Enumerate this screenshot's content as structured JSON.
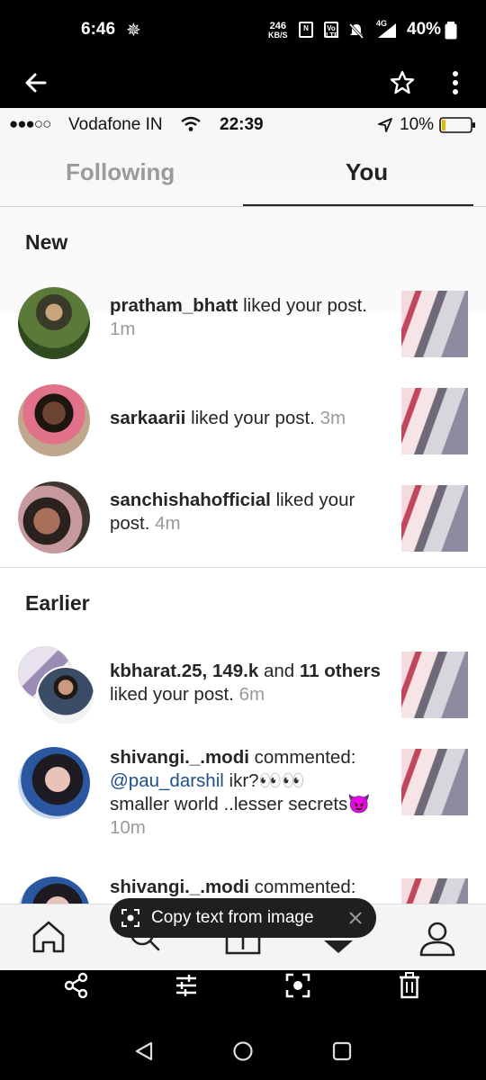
{
  "system_status": {
    "time": "6:46",
    "net_speed_value": "246",
    "net_speed_unit": "KB/S",
    "volte_label": "Vo LTE",
    "network_label": "4G",
    "battery": "40%"
  },
  "ios_status": {
    "carrier": "Vodafone IN",
    "time": "22:39",
    "battery": "10%",
    "signal_dots": "●●●○○"
  },
  "tabs": [
    {
      "label": "Following",
      "active": false
    },
    {
      "label": "You",
      "active": true
    }
  ],
  "sections": {
    "new_title": "New",
    "earlier_title": "Earlier"
  },
  "notifications": [
    {
      "user": "pratham_bhatt",
      "text": "liked your post.",
      "time": "1m"
    },
    {
      "user": "sarkaarii",
      "text": "liked your post.",
      "time": "3m"
    },
    {
      "user": "sanchishahofficial",
      "text": "liked your post.",
      "time": "4m"
    },
    {
      "users": "kbharat.25, 149.k",
      "and": "and",
      "others_count": "11 others",
      "text": "liked your post.",
      "time": "6m"
    },
    {
      "user": "shivangi._.modi",
      "action": "commented:",
      "mention": "@pau_darshil",
      "comment_1": "ikr?",
      "comment_2": "smaller world ..lesser secrets",
      "time": "10m"
    },
    {
      "user": "shivangi._.modi",
      "action": "commented:"
    }
  ],
  "copy_pill": {
    "label": "Copy text from image"
  },
  "icons": {
    "back": "back-arrow-icon",
    "star": "star-icon",
    "more": "more-vert-icon",
    "home": "home-icon",
    "search": "search-icon",
    "add": "add-post-icon",
    "activity": "heart-icon",
    "profile": "profile-icon",
    "share": "share-icon",
    "edit": "edit-icon",
    "lens": "lens-icon",
    "delete": "delete-icon"
  },
  "colors": {
    "mention": "#1c4f8a",
    "timestamp": "#9a9a9a",
    "tab_inactive": "#9a9a9a",
    "tab_active": "#222222"
  }
}
